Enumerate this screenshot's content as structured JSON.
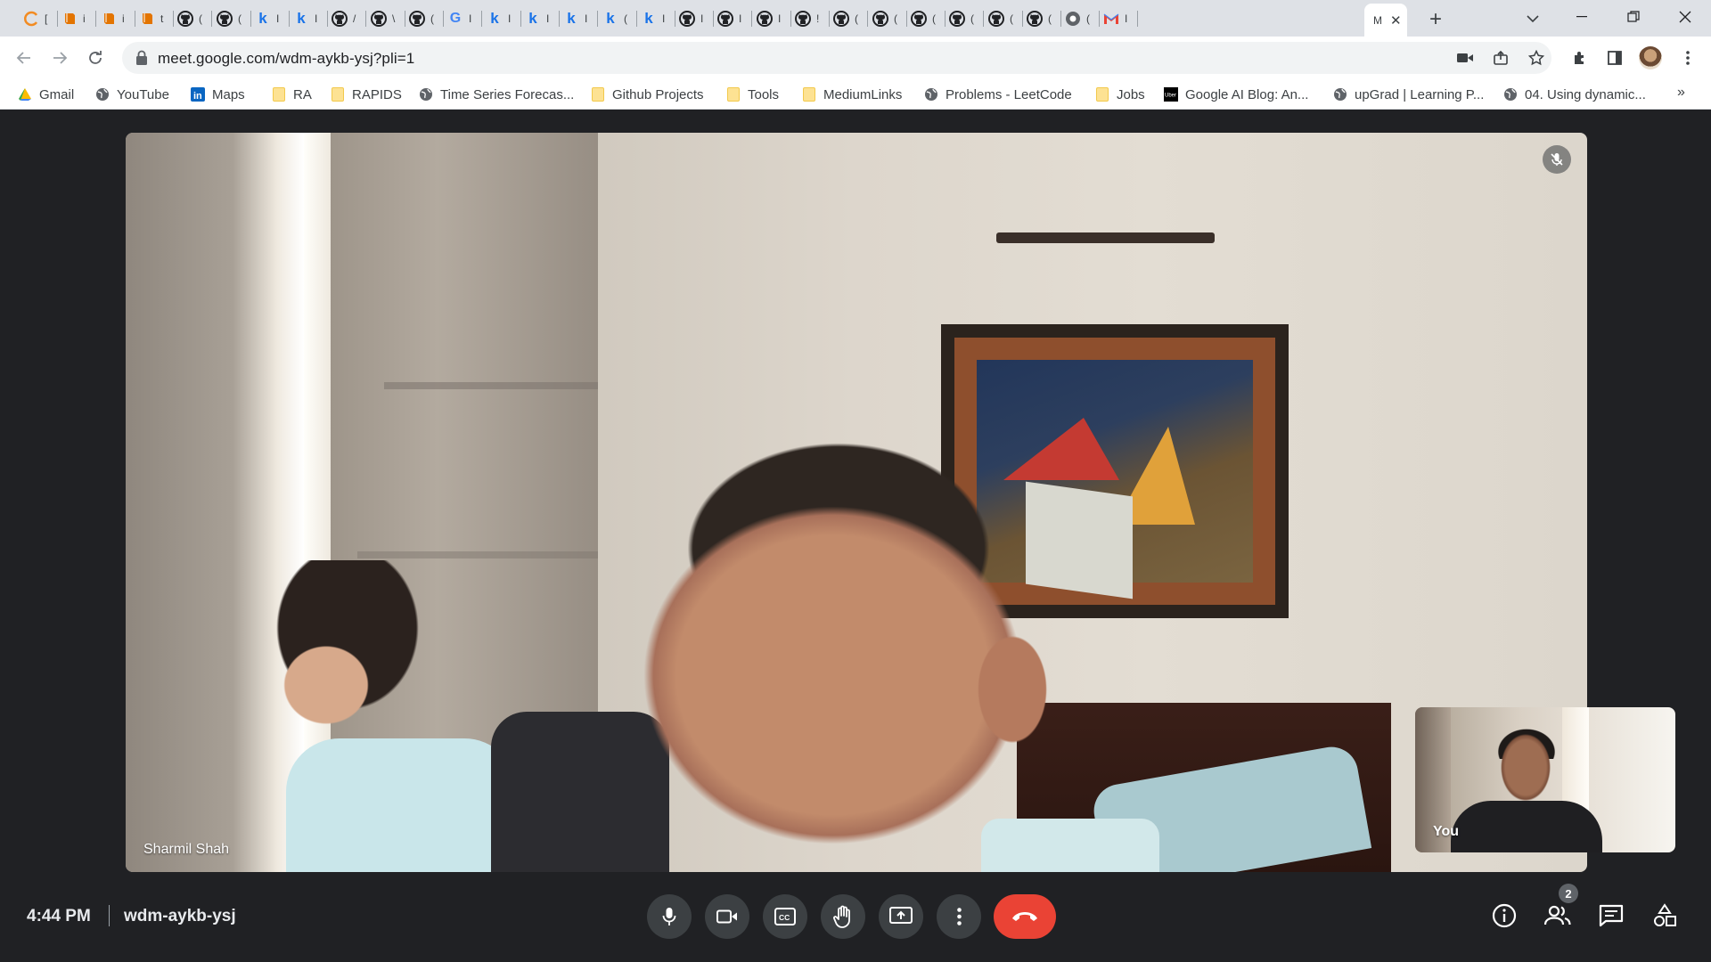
{
  "browser": {
    "tabs": [
      {
        "icon": "c-ring-icon",
        "color": "#f28b22",
        "text": "["
      },
      {
        "icon": "book-icon",
        "color": "#e37400",
        "text": "i"
      },
      {
        "icon": "book-icon",
        "color": "#e37400",
        "text": "i"
      },
      {
        "icon": "book-icon",
        "color": "#e37400",
        "text": "t"
      },
      {
        "icon": "github-icon",
        "color": "#202124",
        "text": "("
      },
      {
        "icon": "github-icon",
        "color": "#202124",
        "text": "("
      },
      {
        "icon": "k-icon",
        "color": "#1a73e8",
        "text": "I"
      },
      {
        "icon": "k-icon",
        "color": "#1a73e8",
        "text": "I"
      },
      {
        "icon": "github-icon",
        "color": "#202124",
        "text": "/"
      },
      {
        "icon": "github-icon",
        "color": "#202124",
        "text": "\\"
      },
      {
        "icon": "github-icon",
        "color": "#202124",
        "text": "("
      },
      {
        "icon": "google-icon",
        "color": "#4285f4",
        "text": "I"
      },
      {
        "icon": "k-icon",
        "color": "#1a73e8",
        "text": "I"
      },
      {
        "icon": "k-icon",
        "color": "#1a73e8",
        "text": "I"
      },
      {
        "icon": "k-icon",
        "color": "#1a73e8",
        "text": "I"
      },
      {
        "icon": "k-icon",
        "color": "#1a73e8",
        "text": "("
      },
      {
        "icon": "k-icon",
        "color": "#1a73e8",
        "text": "I"
      },
      {
        "icon": "github-icon",
        "color": "#202124",
        "text": "I"
      },
      {
        "icon": "github-icon",
        "color": "#202124",
        "text": "I"
      },
      {
        "icon": "github-icon",
        "color": "#202124",
        "text": "I"
      },
      {
        "icon": "github-icon",
        "color": "#202124",
        "text": "!"
      },
      {
        "icon": "github-icon",
        "color": "#202124",
        "text": "("
      },
      {
        "icon": "github-icon",
        "color": "#202124",
        "text": "("
      },
      {
        "icon": "github-icon",
        "color": "#202124",
        "text": "("
      },
      {
        "icon": "github-icon",
        "color": "#202124",
        "text": "("
      },
      {
        "icon": "github-icon",
        "color": "#202124",
        "text": "("
      },
      {
        "icon": "github-icon",
        "color": "#202124",
        "text": "("
      },
      {
        "icon": "chrome-dev-icon",
        "color": "#5f6368",
        "text": "("
      },
      {
        "icon": "gmail-icon",
        "color": "#ea4335",
        "text": "I"
      }
    ],
    "active_tab": {
      "text": "M"
    },
    "url": "meet.google.com/wdm-aykb-ysj?pli=1",
    "bookmarks": [
      {
        "label": "Gmail",
        "icon": "gmail-drive-icon"
      },
      {
        "label": "YouTube",
        "icon": "globe-icon"
      },
      {
        "label": "Maps",
        "icon": "linkedin-icon"
      },
      {
        "label": "RA",
        "icon": "folder-icon"
      },
      {
        "label": "RAPIDS",
        "icon": "folder-icon"
      },
      {
        "label": "Time Series Forecas...",
        "icon": "globe-icon"
      },
      {
        "label": "Github Projects",
        "icon": "folder-icon"
      },
      {
        "label": "Tools",
        "icon": "folder-icon"
      },
      {
        "label": "MediumLinks",
        "icon": "folder-icon"
      },
      {
        "label": "Problems - LeetCode",
        "icon": "globe-icon"
      },
      {
        "label": "Jobs",
        "icon": "folder-icon"
      },
      {
        "label": "Google AI Blog: An...",
        "icon": "uber-icon"
      },
      {
        "label": "upGrad | Learning P...",
        "icon": "globe-icon"
      },
      {
        "label": "04. Using dynamic...",
        "icon": "globe-icon"
      }
    ],
    "bookmarks_more": "»"
  },
  "meet": {
    "main_participant": {
      "name": "Sharmil Shah",
      "muted": true
    },
    "self_view": {
      "name": "You"
    },
    "time": "4:44 PM",
    "meeting_code": "wdm-aykb-ysj",
    "controls": [
      "microphone-icon",
      "camera-icon",
      "captions-icon",
      "raise-hand-icon",
      "present-icon",
      "more-options-icon"
    ],
    "end_call": "end-call-icon",
    "participant_count": "2",
    "colors": {
      "background": "#202124",
      "button": "#3c4043",
      "end_call": "#ea4335"
    }
  }
}
